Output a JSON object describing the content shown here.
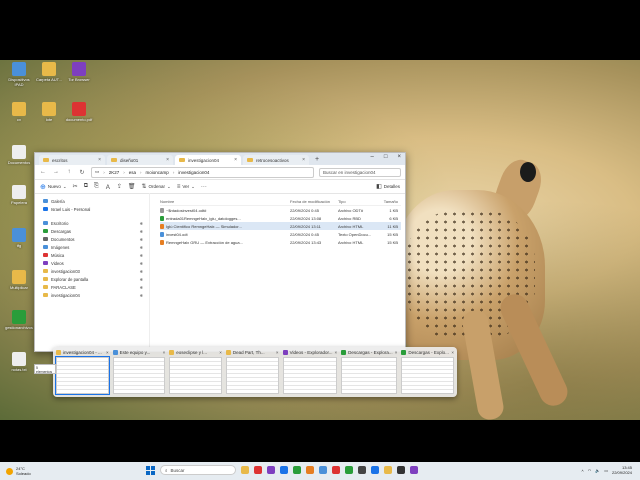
{
  "colors": {
    "folder": "#e8b949",
    "accent": "#1a73e8",
    "selection": "#dbe7f5"
  },
  "desktop_icons": [
    {
      "label": "Dispositivos IPAD",
      "color": "#4a90d9"
    },
    {
      "label": "Carpeta AUT...",
      "color": "#e8b949"
    },
    {
      "label": "Tor Browser",
      "color": "#7e3fbf"
    },
    {
      "label": "cv",
      "color": "#e8b949"
    },
    {
      "label": "lote",
      "color": "#e8b949"
    },
    {
      "label": "documento.pdf",
      "color": "#d33"
    },
    {
      "label": "Documentos",
      "color": "#eee"
    },
    {
      "label": "Papelera",
      "color": "#eee"
    },
    {
      "label": "tfg",
      "color": "#4a90d9"
    },
    {
      "label": "Multiplicar",
      "color": "#e8b949"
    },
    {
      "label": "gestionarchivos",
      "color": "#2a9d3a"
    },
    {
      "label": "notas.txt",
      "color": "#eee"
    }
  ],
  "explorer": {
    "tabs": [
      {
        "label": "escritos"
      },
      {
        "label": "diseño01"
      },
      {
        "label": "investigacion04"
      },
      {
        "label": "retrocesoactivos"
      }
    ],
    "breadcrumb": [
      "2K27",
      "esa",
      "moioncamp",
      "investigacion04"
    ],
    "search_placeholder": "Buscar en investigacion04",
    "toolbar": {
      "new_label": "Nuevo",
      "sort_label": "Ordenar",
      "view_label": "Ver",
      "details_label": "Detalles"
    },
    "sidebar": [
      {
        "label": "Galería",
        "color": "#4a90d9"
      },
      {
        "label": "Israel Luis - Personal",
        "color": "#1a73e8"
      },
      {
        "label": "Escritorio",
        "color": "#4a90d9",
        "pinned": "✱"
      },
      {
        "label": "Descargas",
        "color": "#2a9d3a",
        "pinned": "✱"
      },
      {
        "label": "Documentos",
        "color": "#666",
        "pinned": "✱"
      },
      {
        "label": "Imágenes",
        "color": "#4a90d9",
        "pinned": "✱"
      },
      {
        "label": "Música",
        "color": "#d33",
        "pinned": "✱"
      },
      {
        "label": "Videos",
        "color": "#7e3fbf",
        "pinned": "✱"
      },
      {
        "label": "investigacion03",
        "color": "#e8b949",
        "pinned": "✱"
      },
      {
        "label": "Explorar de pantalla",
        "color": "#e8b949",
        "pinned": "✱"
      },
      {
        "label": "PARACLASE",
        "color": "#e8b949",
        "pinned": "✱"
      },
      {
        "label": "investigacion04",
        "color": "#e8b949",
        "pinned": "✱"
      }
    ],
    "columns": {
      "name": "Nombre",
      "date": "Fecha de modificación",
      "type": "Tipo",
      "size": "Tamaño"
    },
    "files": [
      {
        "name": "~$ntadosinvest04.odt#",
        "date": "22/09/2024 0:45",
        "type": "Archivo ODT#",
        "size": "1 KB",
        "color": "#999",
        "selected": false
      },
      {
        "name": "entrada01RemngeHalx_iglu_datologges...",
        "date": "22/09/2024 13:08",
        "type": "Archivo RBD",
        "size": "6 KB",
        "color": "#2a9d3a",
        "selected": false
      },
      {
        "name": "Iglú Científico RemngeHalx — Simulador...",
        "date": "22/09/2024 13:11",
        "type": "Archivo HTML",
        "size": "11 KB",
        "color": "#e67e22",
        "selected": true
      },
      {
        "name": "invest04.odt",
        "date": "22/09/2024 0:45",
        "type": "Texto OpenDocu...",
        "size": "15 KB",
        "color": "#4a90d9",
        "selected": false
      },
      {
        "name": "RemngeHalx GRU — Extracción de agua...",
        "date": "22/09/2024 13:43",
        "type": "Archivo HTML",
        "size": "15 KB",
        "color": "#e67e22",
        "selected": false
      }
    ]
  },
  "task_view": [
    {
      "label": "investigacion04 - ...",
      "color": "#e8b949"
    },
    {
      "label": "Este equipo y...",
      "color": "#4a90d9"
    },
    {
      "label": "eoseclipse y l...",
      "color": "#e8b949"
    },
    {
      "label": "Dead Part, Th...",
      "color": "#e8b949"
    },
    {
      "label": "Videos - Explorador...",
      "color": "#7e3fbf"
    },
    {
      "label": "Descargas - Explora...",
      "color": "#2a9d3a"
    },
    {
      "label": "Descargas - Explo...",
      "color": "#2a9d3a"
    }
  ],
  "minitip_text": "5 elementos",
  "taskbar": {
    "weather_temp": "24°C",
    "weather_desc": "Soleado",
    "search_label": "Buscar",
    "apps": [
      "#e8b949",
      "#d33",
      "#7e3fbf",
      "#1a73e8",
      "#2a9d3a",
      "#e67e22",
      "#4a90d9",
      "#d33",
      "#2a9d3a",
      "#444",
      "#1a73e8",
      "#e8b949",
      "#333",
      "#7e3fbf"
    ],
    "time": "13:45",
    "date": "22/09/2024"
  }
}
